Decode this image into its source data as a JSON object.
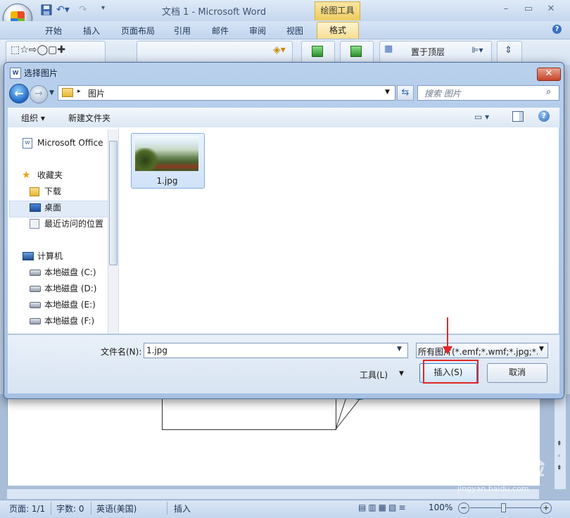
{
  "word": {
    "title": "文档 1 - Microsoft Word",
    "context_tab_group": "绘图工具",
    "tabs": [
      "开始",
      "插入",
      "页面布局",
      "引用",
      "邮件",
      "审阅",
      "视图"
    ],
    "active_tab": "格式",
    "ribbon_arrange_label": "置于顶层",
    "window_controls": [
      "–",
      "▭",
      "✕"
    ],
    "help": "?"
  },
  "dialog": {
    "title": "选择图片",
    "address": {
      "path": "图片"
    },
    "search_placeholder": "搜索 图片",
    "toolbar": {
      "organize": "组织 ▾",
      "new_folder": "新建文件夹",
      "help": "?"
    },
    "nav": {
      "items": [
        {
          "label": "Microsoft Office",
          "icon": "word-doc-icon"
        },
        {
          "label": "收藏夹",
          "icon": "star-icon"
        },
        {
          "label": "下载",
          "icon": "download-folder-icon"
        },
        {
          "label": "桌面",
          "icon": "desktop-icon",
          "selected": true
        },
        {
          "label": "最近访问的位置",
          "icon": "recent-places-icon"
        },
        {
          "label": "计算机",
          "icon": "computer-icon"
        },
        {
          "label": "本地磁盘 (C:)",
          "icon": "drive-c-icon"
        },
        {
          "label": "本地磁盘 (D:)",
          "icon": "drive-icon"
        },
        {
          "label": "本地磁盘 (E:)",
          "icon": "drive-icon"
        },
        {
          "label": "本地磁盘 (F:)",
          "icon": "drive-icon"
        }
      ]
    },
    "files": [
      {
        "name": "1.jpg"
      }
    ],
    "footer": {
      "filename_label": "文件名(N):",
      "filename_value": "1.jpg",
      "filter": "所有图片(*.emf;*.wmf;*.jpg;*.jpeg)",
      "tools": "工具(L)",
      "insert": "插入(S)",
      "cancel": "取消"
    }
  },
  "status": {
    "page": "页面: 1/1",
    "words": "字数: 0",
    "language": "英语(美国)",
    "mode": "插入",
    "zoom": "100%"
  },
  "watermark": {
    "brand": "Baidu经验",
    "url": "jingyan.baidu.com"
  },
  "colors": {
    "annotation_red": "#e3262a",
    "dialog_frame": "#a6c1e3"
  }
}
